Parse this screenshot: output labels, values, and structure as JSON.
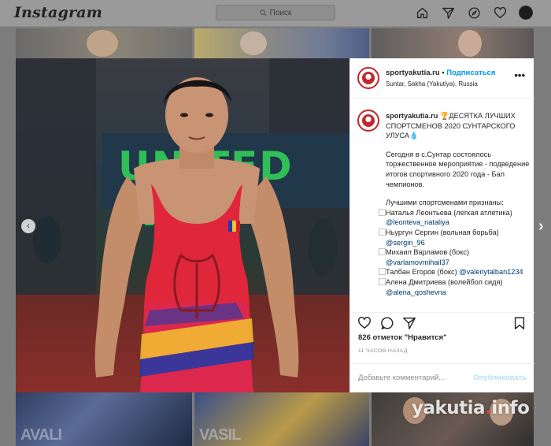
{
  "topbar": {
    "logo": "Instagram",
    "search_placeholder": "Поиск",
    "icons": [
      "home-icon",
      "direct-icon",
      "explore-icon",
      "heart-icon",
      "profile-avatar"
    ]
  },
  "background_tiles": {
    "bottom_left_text": "AVALI",
    "bottom_mid_text": "VASIL"
  },
  "post": {
    "image": {
      "banner_text": "UNITED W",
      "carousel_dots": 8,
      "active_dot": 0
    },
    "header": {
      "username": "sportyakutia.ru",
      "separator": "•",
      "follow_label": "Подписаться",
      "location": "Suntar, Sakha (Yakutiya), Russia",
      "more_label": "•••"
    },
    "caption": {
      "username": "sportyakutia.ru",
      "title": "🏆ДЕСЯТКА ЛУЧШИХ СПОРТСМЕНОВ 2020 СУНТАРСКОГО УЛУСА💧",
      "para1": "Сегодня в с.Сунтар состоялось торжественное мероприятие - подведение итогов спортивного 2020 года - Бал чемпионов.",
      "intro": "Лучшими спортсменами признаны:",
      "items": [
        {
          "text": "⃞Наталья Леонтьева (легкая атлетика) ",
          "mention": "@leonteva_nataliya"
        },
        {
          "text": "⃞Ньургун Сергин (вольная борьба) ",
          "mention": "@sergin_96"
        },
        {
          "text": "⃞Михаил Варламов (бокс) ",
          "mention": "@varlamovmihail37"
        },
        {
          "text": "⃞Талбан Егоров (бокс) ",
          "mention": "@valeriytalban1234"
        },
        {
          "text": "⃞Алена Дмитриева (волейбол сидя) ",
          "mention": "@alena_qoshevna"
        }
      ]
    },
    "likes": "826 отметок \"Нравится\"",
    "time": "11 ЧАСОВ НАЗАД",
    "comment_placeholder": "Добавьте комментарий...",
    "post_label": "Опубликовать"
  },
  "watermark": {
    "part1": "yakutia",
    "dot": ".",
    "part2": "info"
  },
  "colors": {
    "accent": "#0095f6",
    "text": "#262626",
    "muted": "#8e8e8e"
  }
}
